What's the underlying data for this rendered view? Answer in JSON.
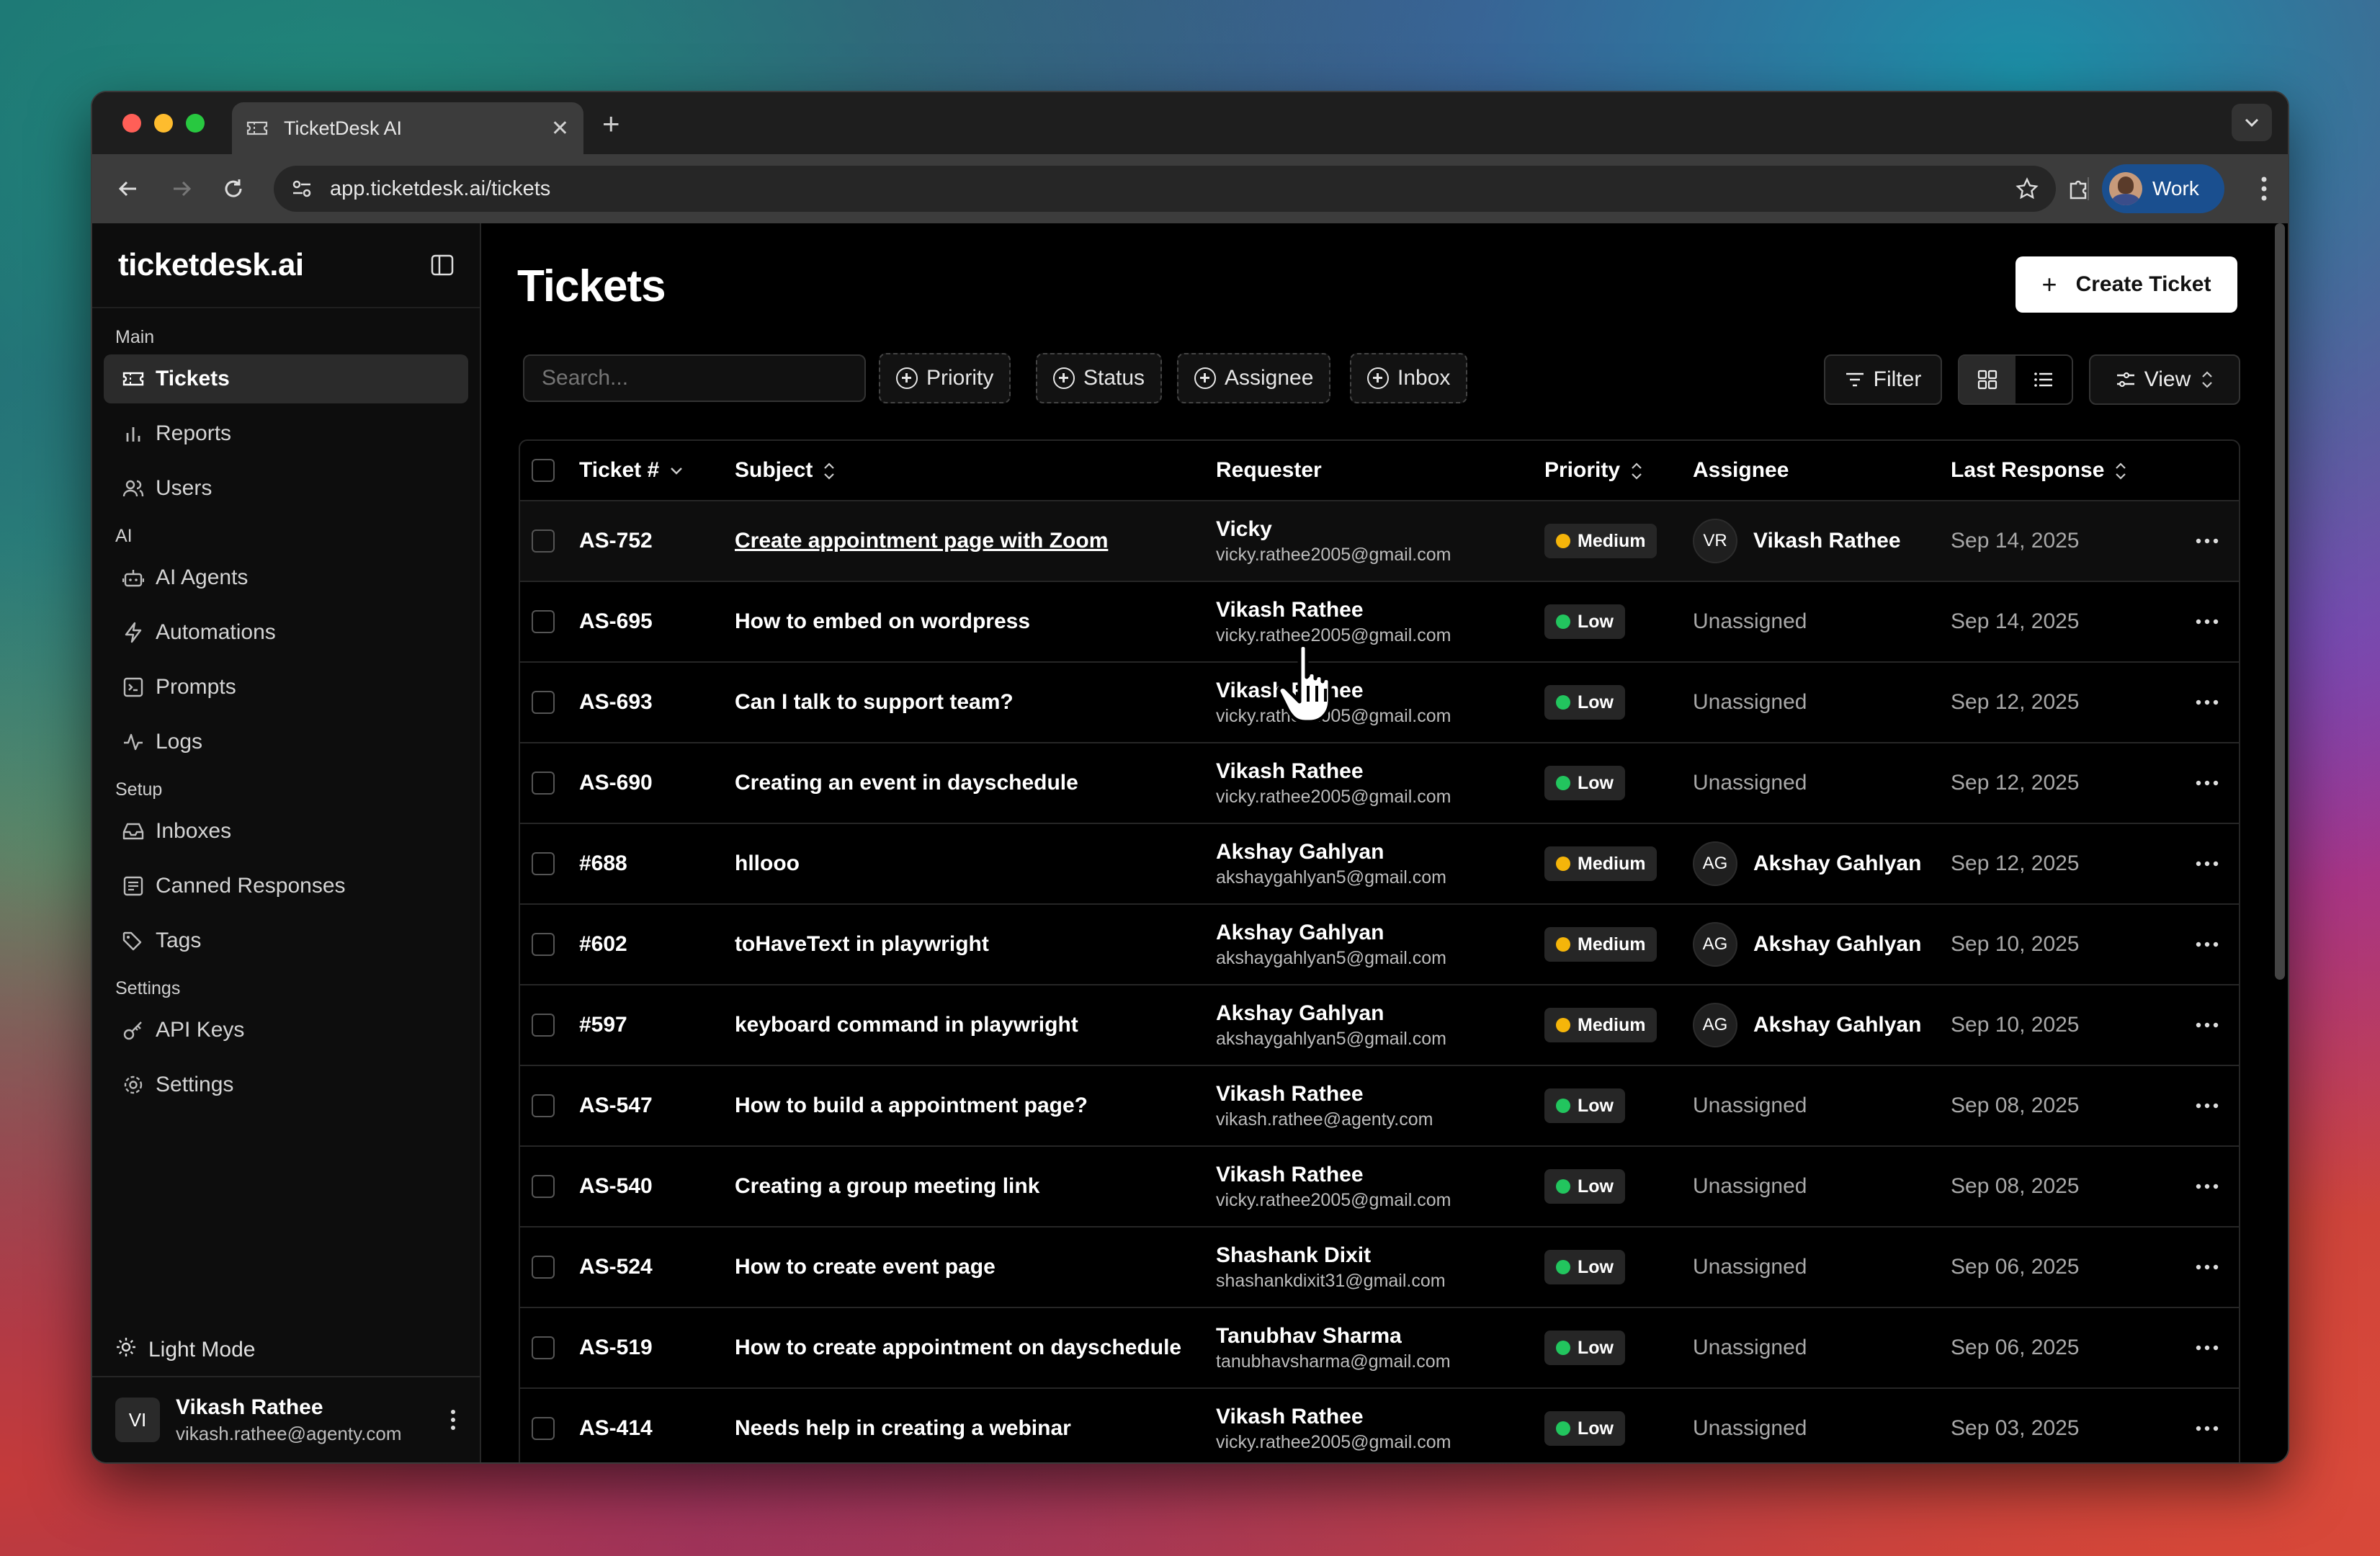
{
  "browser": {
    "tab_title": "TicketDesk AI",
    "url": "app.ticketdesk.ai/tickets",
    "profile_label": "Work"
  },
  "sidebar": {
    "logo": "ticketdesk.ai",
    "sections": [
      {
        "label": "Main",
        "items": [
          {
            "label": "Tickets",
            "icon": "ticket-icon",
            "active": true
          },
          {
            "label": "Reports",
            "icon": "bar-chart-icon"
          },
          {
            "label": "Users",
            "icon": "users-icon"
          }
        ]
      },
      {
        "label": "AI",
        "items": [
          {
            "label": "AI Agents",
            "icon": "bot-icon"
          },
          {
            "label": "Automations",
            "icon": "zap-icon"
          },
          {
            "label": "Prompts",
            "icon": "prompt-icon"
          },
          {
            "label": "Logs",
            "icon": "activity-icon"
          }
        ]
      },
      {
        "label": "Setup",
        "items": [
          {
            "label": "Inboxes",
            "icon": "inbox-icon"
          },
          {
            "label": "Canned Responses",
            "icon": "message-icon"
          },
          {
            "label": "Tags",
            "icon": "tag-icon"
          }
        ]
      },
      {
        "label": "Settings",
        "items": [
          {
            "label": "API Keys",
            "icon": "key-icon"
          },
          {
            "label": "Settings",
            "icon": "gear-icon"
          }
        ]
      }
    ],
    "light_mode": "Light Mode",
    "user": {
      "initials": "VI",
      "name": "Vikash Rathee",
      "email": "vikash.rathee@agenty.com"
    }
  },
  "main": {
    "title": "Tickets",
    "create_button": "Create Ticket",
    "search_placeholder": "Search...",
    "filter_chips": [
      "Priority",
      "Status",
      "Assignee",
      "Inbox"
    ],
    "filter_button": "Filter",
    "view_button": "View"
  },
  "table": {
    "columns": [
      "Ticket #",
      "Subject",
      "Requester",
      "Priority",
      "Assignee",
      "Last Response"
    ],
    "rows": [
      {
        "id": "AS-752",
        "subject": "Create appointment page with Zoom",
        "req_name": "Vicky",
        "req_email": "vicky.rathee2005@gmail.com",
        "priority": "Medium",
        "assignee": "Vikash Rathee",
        "assignee_initials": "VR",
        "date": "Sep 14, 2025"
      },
      {
        "id": "AS-695",
        "subject": "How to embed on wordpress",
        "req_name": "Vikash Rathee",
        "req_email": "vicky.rathee2005@gmail.com",
        "priority": "Low",
        "assignee": "Unassigned",
        "assignee_initials": "",
        "date": "Sep 14, 2025"
      },
      {
        "id": "AS-693",
        "subject": "Can I talk to support team?",
        "req_name": "Vikash Rathee",
        "req_email": "vicky.rathee2005@gmail.com",
        "priority": "Low",
        "assignee": "Unassigned",
        "assignee_initials": "",
        "date": "Sep 12, 2025"
      },
      {
        "id": "AS-690",
        "subject": "Creating an event in dayschedule",
        "req_name": "Vikash Rathee",
        "req_email": "vicky.rathee2005@gmail.com",
        "priority": "Low",
        "assignee": "Unassigned",
        "assignee_initials": "",
        "date": "Sep 12, 2025"
      },
      {
        "id": "#688",
        "subject": "hllooo",
        "req_name": "Akshay Gahlyan",
        "req_email": "akshaygahlyan5@gmail.com",
        "priority": "Medium",
        "assignee": "Akshay Gahlyan",
        "assignee_initials": "AG",
        "date": "Sep 12, 2025"
      },
      {
        "id": "#602",
        "subject": "toHaveText in playwright",
        "req_name": "Akshay Gahlyan",
        "req_email": "akshaygahlyan5@gmail.com",
        "priority": "Medium",
        "assignee": "Akshay Gahlyan",
        "assignee_initials": "AG",
        "date": "Sep 10, 2025"
      },
      {
        "id": "#597",
        "subject": "keyboard command in playwright",
        "req_name": "Akshay Gahlyan",
        "req_email": "akshaygahlyan5@gmail.com",
        "priority": "Medium",
        "assignee": "Akshay Gahlyan",
        "assignee_initials": "AG",
        "date": "Sep 10, 2025"
      },
      {
        "id": "AS-547",
        "subject": "How to build a appointment page?",
        "req_name": "Vikash Rathee",
        "req_email": "vikash.rathee@agenty.com",
        "priority": "Low",
        "assignee": "Unassigned",
        "assignee_initials": "",
        "date": "Sep 08, 2025"
      },
      {
        "id": "AS-540",
        "subject": "Creating a group meeting link",
        "req_name": "Vikash Rathee",
        "req_email": "vicky.rathee2005@gmail.com",
        "priority": "Low",
        "assignee": "Unassigned",
        "assignee_initials": "",
        "date": "Sep 08, 2025"
      },
      {
        "id": "AS-524",
        "subject": "How to create event page",
        "req_name": "Shashank Dixit",
        "req_email": "shashankdixit31@gmail.com",
        "priority": "Low",
        "assignee": "Unassigned",
        "assignee_initials": "",
        "date": "Sep 06, 2025"
      },
      {
        "id": "AS-519",
        "subject": "How to create appointment on dayschedule",
        "req_name": "Tanubhav Sharma",
        "req_email": "tanubhavsharma@gmail.com",
        "priority": "Low",
        "assignee": "Unassigned",
        "assignee_initials": "",
        "date": "Sep 06, 2025"
      },
      {
        "id": "AS-414",
        "subject": "Needs help in creating a webinar",
        "req_name": "Vikash Rathee",
        "req_email": "vicky.rathee2005@gmail.com",
        "priority": "Low",
        "assignee": "Unassigned",
        "assignee_initials": "",
        "date": "Sep 03, 2025"
      }
    ]
  },
  "colors": {
    "medium": "#f5b50a",
    "low": "#22c55e",
    "accent": "#ffffff"
  }
}
